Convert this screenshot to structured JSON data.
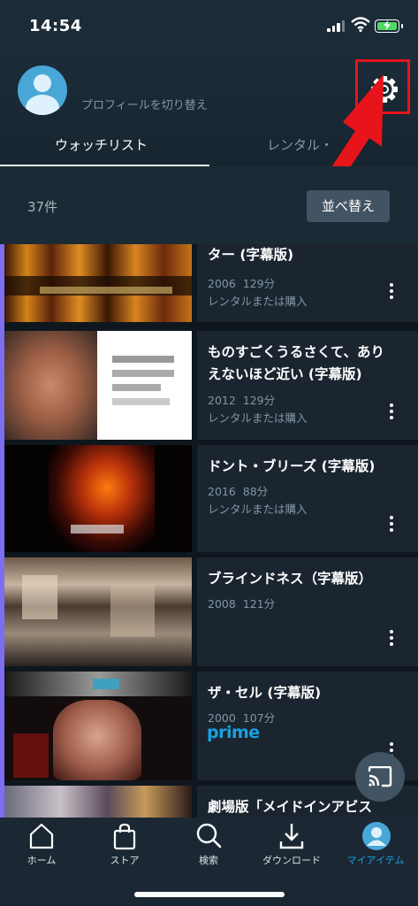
{
  "status_bar": {
    "time": "14:54"
  },
  "header": {
    "profile_switch": "プロフィールを切り替え",
    "tabs": [
      {
        "label": "ウォッチリスト",
        "active": true
      },
      {
        "label": "レンタル・",
        "active": false
      }
    ]
  },
  "toolbar": {
    "count": "37件",
    "sort_label": "並べ替え"
  },
  "items": [
    {
      "title": "ター (字幕版)",
      "year": "2006",
      "duration": "129分",
      "availability": "レンタルまたは購入"
    },
    {
      "title": "ものすごくうるさくて、ありえないほど近い (字幕版)",
      "year": "2012",
      "duration": "129分",
      "availability": "レンタルまたは購入"
    },
    {
      "title": "ドント・ブリーズ (字幕版)",
      "year": "2016",
      "duration": "88分",
      "availability": "レンタルまたは購入"
    },
    {
      "title": "ブラインドネス（字幕版）",
      "year": "2008",
      "duration": "121分",
      "availability": ""
    },
    {
      "title": "ザ・セル (字幕版)",
      "year": "2000",
      "duration": "107分",
      "availability": "prime"
    },
    {
      "title": "劇場版「メイドインアビス",
      "year": "",
      "duration": "",
      "availability": ""
    }
  ],
  "tabbar": {
    "items": [
      {
        "label": "ホーム",
        "icon": "home-icon"
      },
      {
        "label": "ストア",
        "icon": "store-bag-icon"
      },
      {
        "label": "検索",
        "icon": "search-icon"
      },
      {
        "label": "ダウンロード",
        "icon": "download-icon"
      },
      {
        "label": "マイアイテム",
        "icon": "avatar-icon",
        "active": true
      }
    ]
  },
  "colors": {
    "accent": "#1aa0de",
    "highlight": "#e8141b",
    "background": "#0f171e",
    "active_tab": "#1aa0de"
  }
}
